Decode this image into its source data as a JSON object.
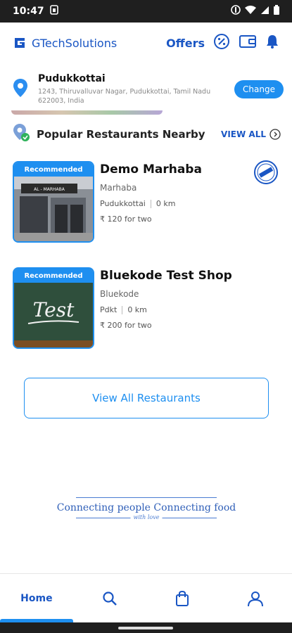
{
  "status": {
    "time": "10:47"
  },
  "header": {
    "brand": "GTechSolutions",
    "offers_label": "Offers"
  },
  "location": {
    "name": "Pudukkottai",
    "address": "1243, Thiruvalluvar Nagar, Pudukkottai, Tamil Nadu 622003, India",
    "change_label": "Change"
  },
  "section": {
    "title": "Popular Restaurants Nearby",
    "view_all": "VIEW ALL"
  },
  "restaurants": [
    {
      "badge": "Recommended",
      "name": "Demo Marhaba",
      "cuisine": "Marhaba",
      "area": "Pudukkottai",
      "distance": "0 km",
      "cost": "₹ 120 for two",
      "thumb_sign": "AL - MARHABA"
    },
    {
      "badge": "Recommended",
      "name": "Bluekode Test Shop",
      "cuisine": "Bluekode",
      "area": "Pdkt",
      "distance": "0 km",
      "cost": "₹ 200 for two",
      "thumb_text": "Test"
    }
  ],
  "view_all_button": "View All Restaurants",
  "tagline": {
    "text": "Connecting people Connecting food",
    "script": "with love"
  },
  "nav": {
    "home": "Home"
  },
  "colors": {
    "primary": "#1a56c4",
    "accent": "#1e8ff0"
  }
}
